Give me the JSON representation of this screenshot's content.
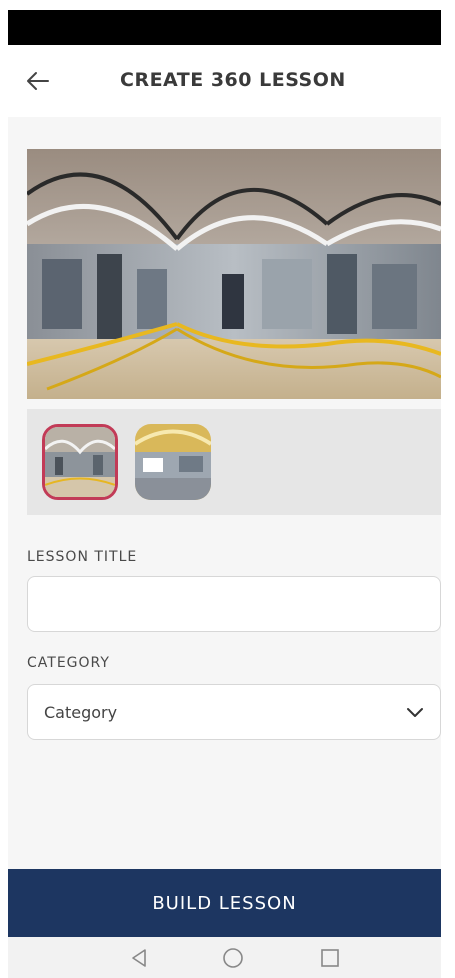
{
  "app_bar": {
    "title": "CREATE 360 LESSON",
    "back_icon": "arrow-left-icon"
  },
  "gallery": {
    "hero_image": "panorama-lab-image",
    "thumbnails": [
      {
        "image": "panorama-lab-thumbnail",
        "selected": true
      },
      {
        "image": "panorama-workshop-thumbnail",
        "selected": false
      }
    ]
  },
  "form": {
    "lesson_title_label": "LESSON TITLE",
    "lesson_title_value": "",
    "category_label": "CATEGORY",
    "category_value": "Category",
    "category_icon": "chevron-down-icon"
  },
  "actions": {
    "build_label": "BUILD LESSON"
  },
  "system_nav": {
    "back": "triangle-back-icon",
    "home": "circle-home-icon",
    "recents": "square-recents-icon"
  },
  "colors": {
    "primary": "#1d3661",
    "selected_border": "#c23b57",
    "background": "#f6f6f6"
  }
}
